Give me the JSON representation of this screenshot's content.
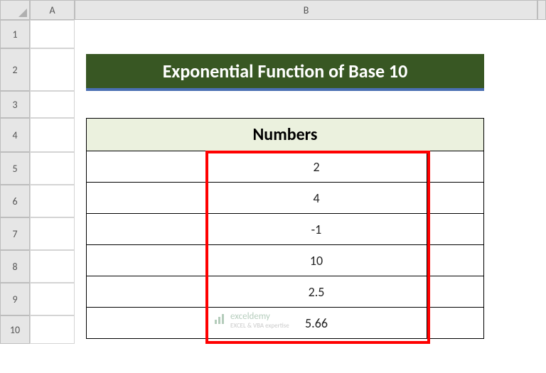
{
  "columns": [
    "A",
    "B"
  ],
  "row_headers": [
    "1",
    "2",
    "3",
    "4",
    "5",
    "6",
    "7",
    "8",
    "9",
    "10"
  ],
  "title": "Exponential Function of Base 10",
  "table_header": "Numbers",
  "chart_data": {
    "type": "table",
    "title": "Numbers",
    "columns": [
      "Numbers"
    ],
    "values": [
      2,
      4,
      -1,
      10,
      2.5,
      5.66
    ]
  },
  "watermark": {
    "brand": "exceldemy",
    "tagline": "EXCEL & VBA expertise"
  }
}
